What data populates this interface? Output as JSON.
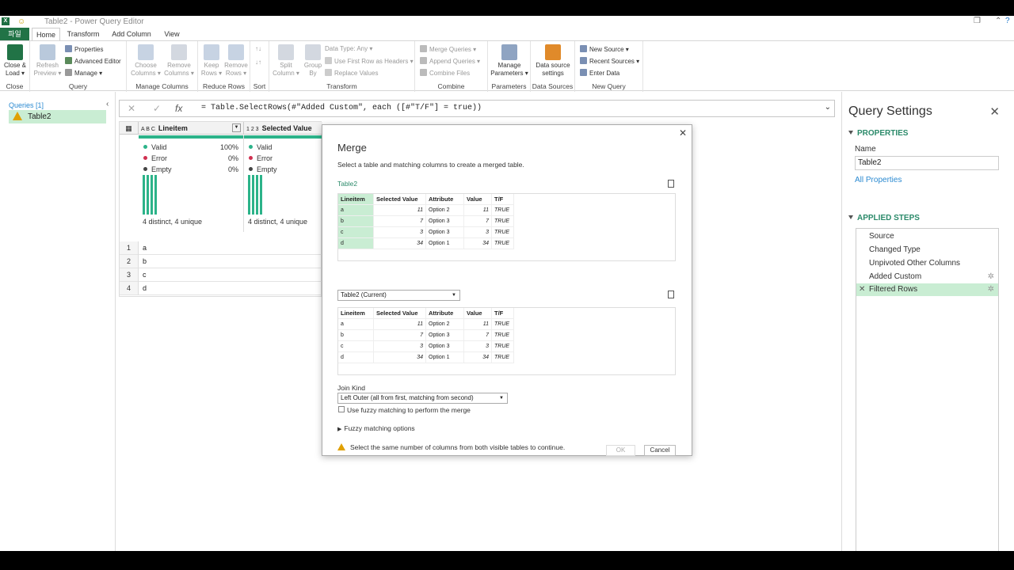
{
  "titlebar": {
    "title": "Table2 - Power Query Editor"
  },
  "tabs": {
    "file": "파일",
    "home": "Home",
    "transform": "Transform",
    "add_column": "Add Column",
    "view": "View"
  },
  "ribbon": {
    "close_load": "Close & Load ▾",
    "close_group": "Close",
    "refresh_preview": "Refresh Preview ▾",
    "properties": "Properties",
    "advanced_editor": "Advanced Editor",
    "manage": "Manage ▾",
    "query_group": "Query",
    "choose_columns": "Choose Columns ▾",
    "remove_columns": "Remove Columns ▾",
    "manage_columns_group": "Manage Columns",
    "keep_rows": "Keep Rows ▾",
    "remove_rows": "Remove Rows ▾",
    "reduce_rows_group": "Reduce Rows",
    "sort_group": "Sort",
    "split_column": "Split Column ▾",
    "group_by": "Group By",
    "data_type": "Data Type: Any ▾",
    "use_first_row": "Use First Row as Headers ▾",
    "replace_values": "Replace Values",
    "transform_group": "Transform",
    "merge_queries": "Merge Queries ▾",
    "append_queries": "Append Queries ▾",
    "combine_files": "Combine Files",
    "combine_group": "Combine",
    "manage_parameters": "Manage Parameters ▾",
    "parameters_group": "Parameters",
    "data_source_settings": "Data source settings",
    "data_sources_group": "Data Sources",
    "new_source": "New Source ▾",
    "recent_sources": "Recent Sources ▾",
    "enter_data": "Enter Data",
    "new_query_group": "New Query"
  },
  "queries": {
    "header": "Queries [1]",
    "items": [
      {
        "label": "Table2"
      }
    ]
  },
  "formula": {
    "text": "= Table.SelectRows(#\"Added Custom\", each ([#\"T/F\"] = true))"
  },
  "grid": {
    "col1_name": "Lineitem",
    "col2_name": "Selected Value",
    "col1_type": "A B C",
    "col2_type": "1 2 3",
    "profile1": {
      "valid": "Valid",
      "valid_pct": "100%",
      "error": "Error",
      "error_pct": "0%",
      "empty": "Empty",
      "empty_pct": "0%",
      "distinct": "4 distinct, 4 unique"
    },
    "profile2": {
      "valid": "Valid",
      "error": "Error",
      "empty": "Empty",
      "distinct": "4 distinct, 4 unique"
    },
    "rows": [
      {
        "n": "1",
        "v": "a"
      },
      {
        "n": "2",
        "v": "b"
      },
      {
        "n": "3",
        "v": "c"
      },
      {
        "n": "4",
        "v": "d"
      }
    ]
  },
  "merge": {
    "title": "Merge",
    "subtitle": "Select a table and matching columns to create a merged table.",
    "table1_name": "Table2",
    "headers": [
      "Lineitem",
      "Selected Value",
      "Attribute",
      "Value",
      "T/F"
    ],
    "rows": [
      [
        "a",
        "11",
        "Option 2",
        "11",
        "TRUE"
      ],
      [
        "b",
        "7",
        "Option 3",
        "7",
        "TRUE"
      ],
      [
        "c",
        "3",
        "Option 3",
        "3",
        "TRUE"
      ],
      [
        "d",
        "34",
        "Option 1",
        "34",
        "TRUE"
      ]
    ],
    "second_table": "Table2 (Current)",
    "join_kind_label": "Join Kind",
    "join_kind": "Left Outer (all from first, matching from second)",
    "fuzzy_checkbox": "Use fuzzy matching to perform the merge",
    "fuzzy_options": "Fuzzy matching options",
    "warning": "Select the same number of columns from both visible tables to continue.",
    "ok": "OK",
    "cancel": "Cancel"
  },
  "settings": {
    "title": "Query Settings",
    "properties": "PROPERTIES",
    "name_label": "Name",
    "name_value": "Table2",
    "all_properties": "All Properties",
    "applied_steps": "APPLIED STEPS",
    "steps": [
      {
        "label": "Source"
      },
      {
        "label": "Changed Type"
      },
      {
        "label": "Unpivoted Other Columns"
      },
      {
        "label": "Added Custom"
      },
      {
        "label": "Filtered Rows"
      }
    ]
  },
  "colors": {
    "accent": "#217346",
    "selection": "#c9edd3",
    "profile": "#2cb389",
    "link": "#2b8ad1"
  }
}
